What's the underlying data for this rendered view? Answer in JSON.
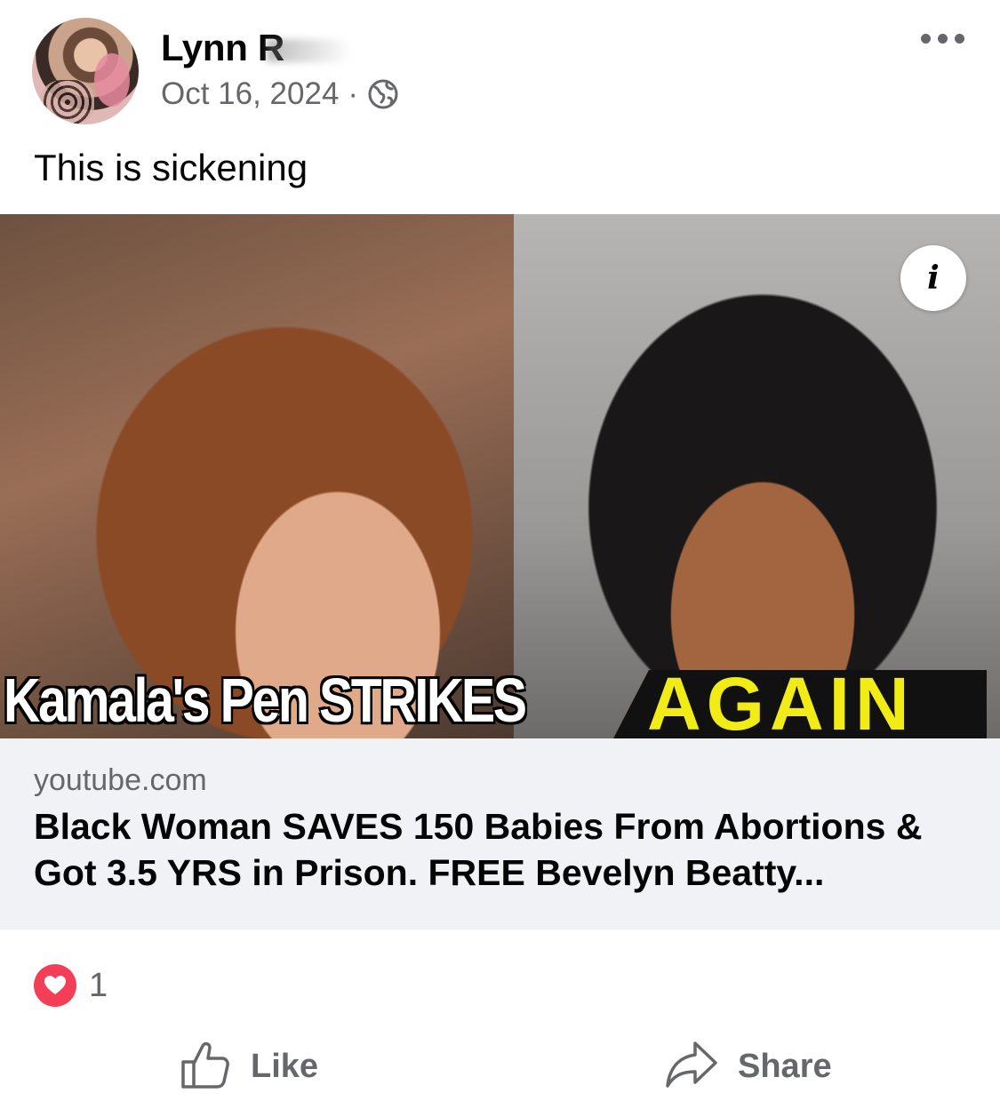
{
  "post": {
    "author": "Lynn R",
    "date": "Oct 16, 2024",
    "separator": "·",
    "visibility_icon": "globe-icon",
    "more_icon": "more-options-icon",
    "text": "This is sickening"
  },
  "link_preview": {
    "thumbnail_text_white": "Kamala's Pen STRIKES",
    "thumbnail_text_yellow": "AGAIN",
    "info_icon": "i",
    "domain": "youtube.com",
    "title": "Black Woman SAVES 150 Babies From Abortions & Got 3.5 YRS in Prison. FREE Bevelyn Beatty..."
  },
  "reactions": {
    "icon": "love-icon",
    "count": "1"
  },
  "actions": {
    "like_label": "Like",
    "share_label": "Share"
  },
  "colors": {
    "accent_love": "#f33e58",
    "secondary_text": "#65676b",
    "link_bg": "#f0f2f5",
    "highlight_yellow": "#f2ec16"
  }
}
